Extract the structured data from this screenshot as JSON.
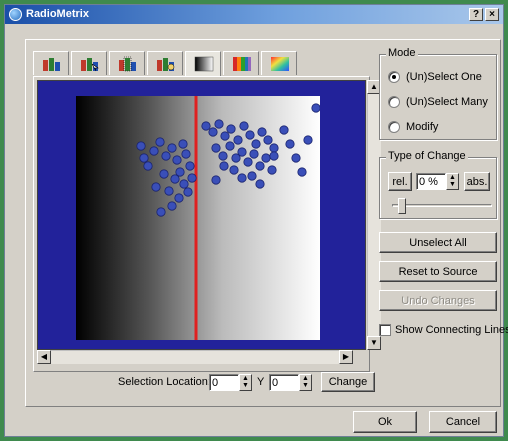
{
  "window": {
    "title": "RadioMetrix",
    "help_label": "?",
    "close_label": "×"
  },
  "tabs": [
    {
      "icon": "bars-icon",
      "active": false
    },
    {
      "icon": "bars-cursor-icon",
      "active": false
    },
    {
      "icon": "bars-select-icon",
      "active": false
    },
    {
      "icon": "bars-hand-icon",
      "active": false
    },
    {
      "icon": "gradient-icon",
      "active": true
    },
    {
      "icon": "color-strip-icon",
      "active": false
    },
    {
      "icon": "color-gradient-icon",
      "active": false
    }
  ],
  "mode": {
    "title": "Mode",
    "options": [
      {
        "label": "(Un)Select One",
        "selected": true
      },
      {
        "label": "(Un)Select Many",
        "selected": false
      },
      {
        "label": "Modify",
        "selected": false
      }
    ]
  },
  "type_of_change": {
    "title": "Type of Change",
    "rel_label": "rel.",
    "value": "0 %",
    "abs_label": "abs.",
    "slider_level": 0.1
  },
  "buttons": {
    "unselect_all": "Unselect All",
    "reset_to_source": "Reset to Source",
    "undo_changes": "Undo Changes",
    "ok": "Ok",
    "cancel": "Cancel",
    "change": "Change"
  },
  "show_connecting_lines": {
    "label": "Show Connecting Lines",
    "checked": false
  },
  "selection_location": {
    "label": "Selection Location: X",
    "x_value": "0",
    "y_label": "Y",
    "y_value": "0"
  },
  "colors": {
    "plot_border": "#22229a",
    "point_fill": "#3a4fb8",
    "line_color": "#e02020"
  }
}
